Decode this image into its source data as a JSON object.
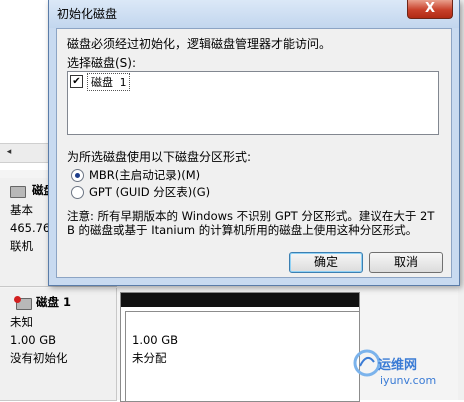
{
  "background": {
    "disk0": {
      "title_fragment": "磁盘",
      "type": "基本",
      "size_fragment": "465.76",
      "status_fragment": "联机"
    },
    "disk1": {
      "title": "磁盘 1",
      "type": "未知",
      "size": "1.00 GB",
      "status": "没有初始化"
    },
    "partition": {
      "size": "1.00 GB",
      "state": "未分配"
    },
    "scroll_left_icon": "chevron-left-icon"
  },
  "dialog": {
    "title": "初始化磁盘",
    "close_label": "X",
    "message": "磁盘必须经过初始化，逻辑磁盘管理器才能访问。",
    "select_label": "选择磁盘(S):",
    "disks": [
      {
        "label": "磁盘 1",
        "checked": true
      }
    ],
    "partition_style_label": "为所选磁盘使用以下磁盘分区形式:",
    "options": [
      {
        "label": "MBR(主启动记录)(M)",
        "selected": true
      },
      {
        "label": "GPT (GUID 分区表)(G)",
        "selected": false
      }
    ],
    "note": "注意: 所有早期版本的 Windows 不识别 GPT 分区形式。建议在大于 2TB 的磁盘或基于 Itanium 的计算机所用的磁盘上使用这种分区形式。",
    "ok_label": "确定",
    "cancel_label": "取消"
  },
  "watermark": {
    "line1": "运维网",
    "line2": "iyunv.com"
  },
  "colors": {
    "dialog_frame": "#c8daf0",
    "close_button": "#c8402a",
    "unallocated_bar": "#111111"
  }
}
